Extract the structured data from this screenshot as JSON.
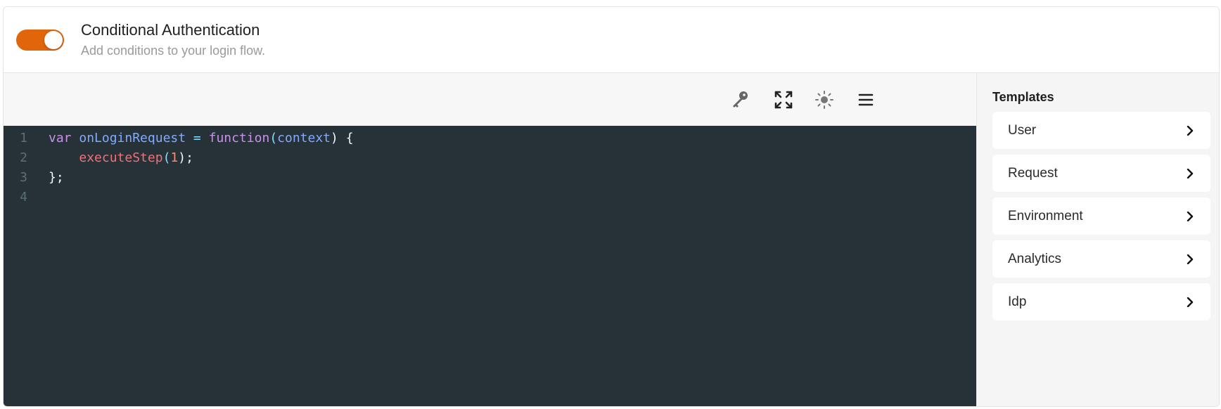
{
  "header": {
    "toggle_on": true,
    "title": "Conditional Authentication",
    "subtitle": "Add conditions to your login flow."
  },
  "toolbar": {
    "icons": [
      "key-icon",
      "fullscreen-icon",
      "theme-sun-icon",
      "menu-icon"
    ]
  },
  "editor": {
    "line_numbers": [
      "1",
      "2",
      "3",
      "4"
    ],
    "line1": {
      "kw1": "var",
      "name": "onLoginRequest",
      "op": "=",
      "kw2": "function",
      "p1": "(",
      "param": "context",
      "p2": ") {"
    },
    "line2": {
      "indent": "    ",
      "call": "executeStep",
      "p1": "(",
      "num": "1",
      "p2": ");"
    },
    "line3": {
      "text": "};"
    }
  },
  "templates": {
    "heading": "Templates",
    "items": [
      {
        "label": "User"
      },
      {
        "label": "Request"
      },
      {
        "label": "Environment"
      },
      {
        "label": "Analytics"
      },
      {
        "label": "Idp"
      }
    ]
  },
  "colors": {
    "accent": "#e0650b",
    "editor_bg": "#263238"
  }
}
